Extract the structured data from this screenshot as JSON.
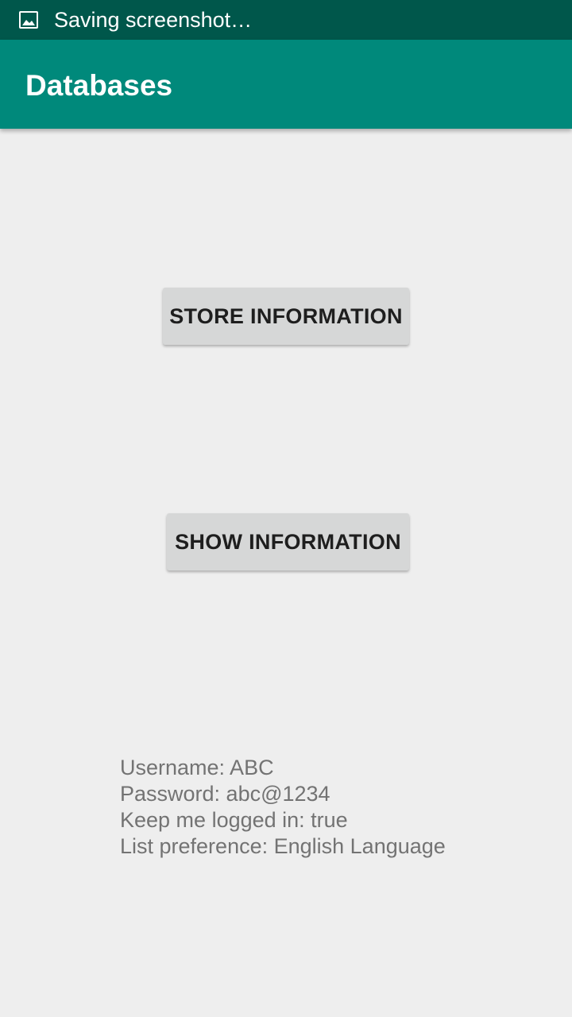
{
  "status_bar": {
    "icon": "image-icon",
    "text": "Saving screenshot…"
  },
  "app_bar": {
    "title": "Databases",
    "color": "#00897b",
    "status_color": "#00574b"
  },
  "buttons": {
    "store_label": "STORE INFORMATION",
    "show_label": "SHOW INFORMATION"
  },
  "info": {
    "username": "Username: ABC",
    "password": "Password: abc@1234",
    "keep_logged_in": "Keep me logged in: true",
    "list_preference": "List preference: English Language"
  }
}
